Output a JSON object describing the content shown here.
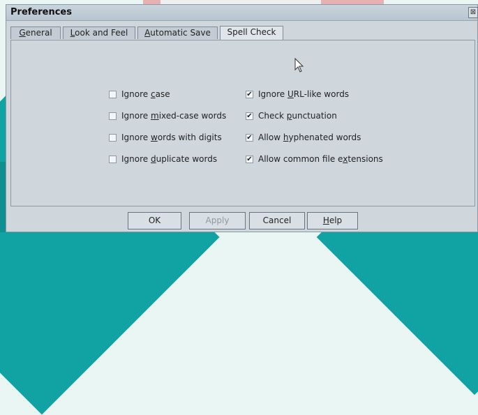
{
  "window": {
    "title": "Preferences",
    "close_glyph": "⊠"
  },
  "tabs": [
    {
      "label": "General",
      "mnemonic": "G",
      "rest": "eneral",
      "active": false
    },
    {
      "label": "Look and Feel",
      "mnemonic": "L",
      "rest": "ook and Feel",
      "active": false
    },
    {
      "label": "Automatic Save",
      "mnemonic": "A",
      "rest": "utomatic Save",
      "active": false
    },
    {
      "label": "Spell Check",
      "mnemonic": "",
      "rest": "Spell Check",
      "active": true
    }
  ],
  "options": {
    "left": [
      {
        "a": "Ignore ",
        "u": "c",
        "b": "ase",
        "checked": false
      },
      {
        "a": "Ignore ",
        "u": "m",
        "b": "ixed-case words",
        "checked": false
      },
      {
        "a": "Ignore ",
        "u": "w",
        "b": "ords with digits",
        "checked": false
      },
      {
        "a": "Ignore ",
        "u": "d",
        "b": "uplicate words",
        "checked": false
      }
    ],
    "right": [
      {
        "a": "Ignore ",
        "u": "U",
        "b": "RL-like words",
        "checked": true
      },
      {
        "a": "Check ",
        "u": "p",
        "b": "unctuation",
        "checked": true
      },
      {
        "a": "Allow ",
        "u": "h",
        "b": "yphenated words",
        "checked": true
      },
      {
        "a": "Allow common file e",
        "u": "x",
        "b": "tensions",
        "checked": true
      }
    ]
  },
  "buttons": {
    "ok": "OK",
    "apply": "Apply",
    "cancel": "Cancel",
    "help_u": "H",
    "help_rest": "elp"
  },
  "colors": {
    "teal": "#0f8f8f",
    "window": "#cfd6dc"
  }
}
